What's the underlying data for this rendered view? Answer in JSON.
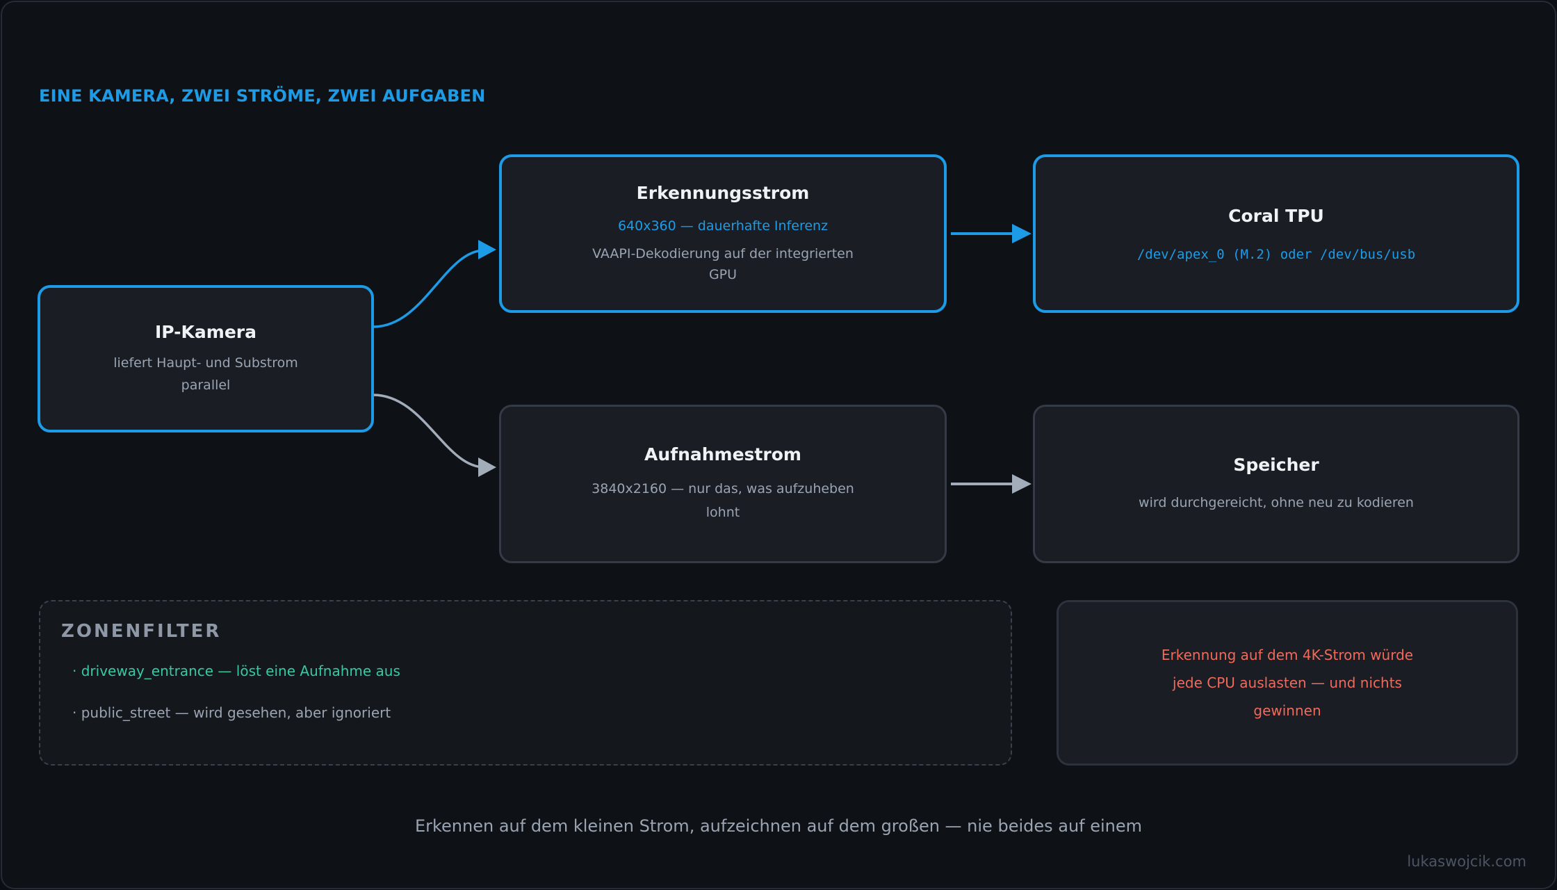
{
  "heading": "EINE KAMERA, ZWEI STRÖME, ZWEI AUFGABEN",
  "nodes": {
    "camera": {
      "title": "IP-Kamera",
      "sub_line1": "liefert Haupt- und Substrom",
      "sub_line2": "parallel"
    },
    "detect_stream": {
      "title": "Erkennungsstrom",
      "highlight": "640x360 — dauerhafte Inferenz",
      "sub_line1": "VAAPI-Dekodierung auf der integrierten",
      "sub_line2": "GPU"
    },
    "coral": {
      "title": "Coral TPU",
      "mono": "/dev/apex_0 (M.2) oder /dev/bus/usb"
    },
    "record_stream": {
      "title": "Aufnahmestrom",
      "sub_line1": "3840x2160 — nur das, was aufzuheben",
      "sub_line2": "lohnt"
    },
    "storage": {
      "title": "Speicher",
      "sub": "wird durchgereicht, ohne neu zu kodieren"
    }
  },
  "zone_filter": {
    "title": "ZONENFILTER",
    "items": [
      "· driveway_entrance — löst eine Aufnahme aus",
      "· public_street — wird gesehen, aber ignoriert"
    ]
  },
  "warning": {
    "line1": "Erkennung auf dem 4K-Strom würde",
    "line2": "jede CPU auslasten — und nichts",
    "line3": "gewinnen"
  },
  "caption": "Erkennen auf dem kleinen Strom, aufzeichnen auf dem großen — nie beides auf einem",
  "watermark": "lukaswojcik.com",
  "colors": {
    "accent": "#1d9be6",
    "muted_arrow": "#a3adba",
    "zone_active": "#36c9a4",
    "warning": "#f06a5c"
  }
}
